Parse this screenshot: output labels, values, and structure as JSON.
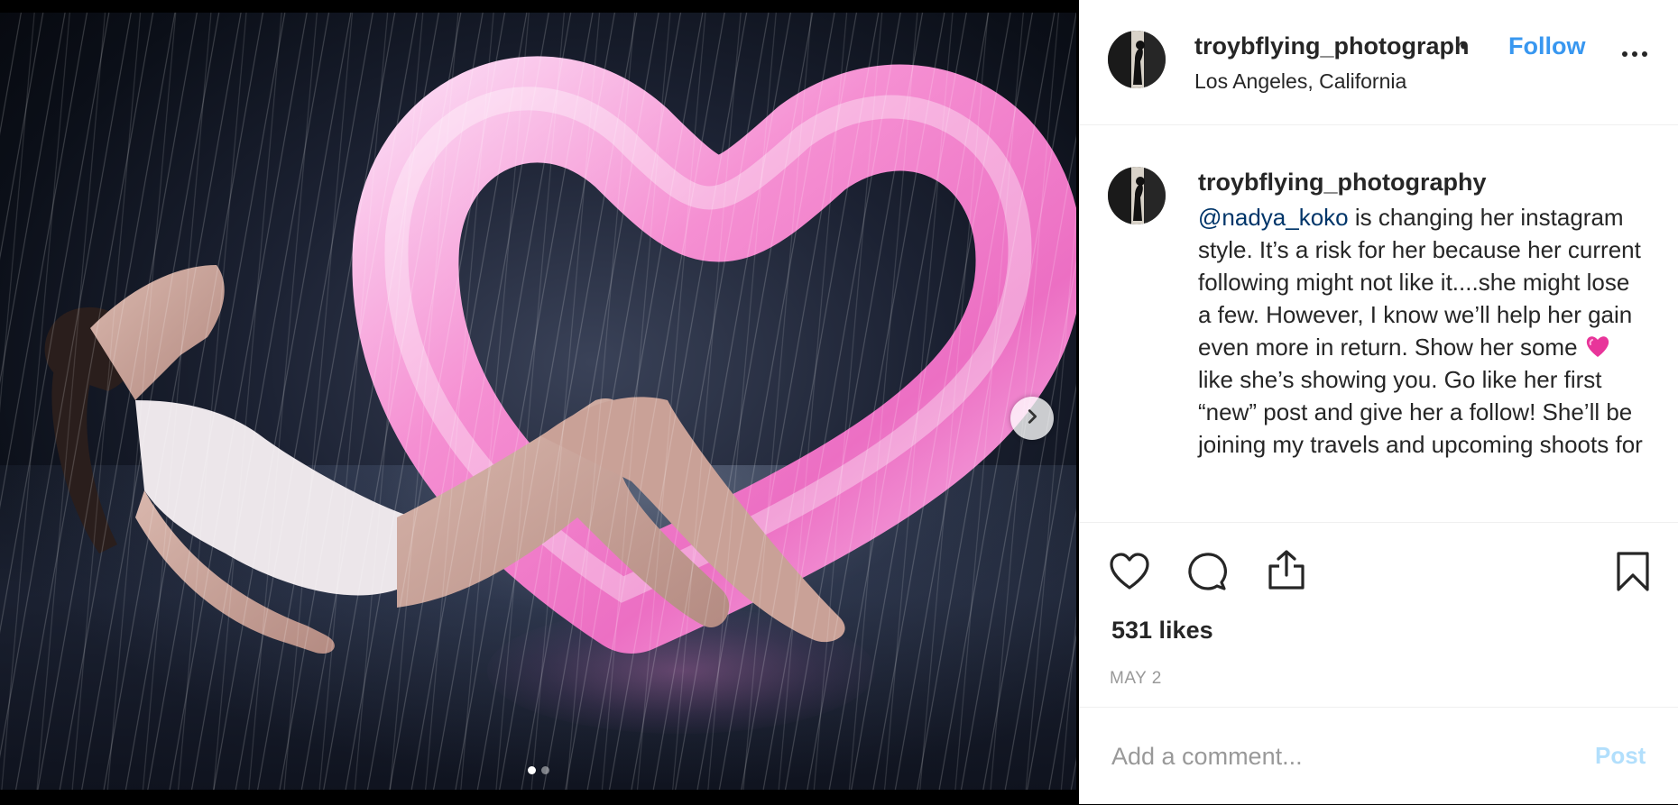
{
  "post": {
    "photo": {
      "slide_count": 2,
      "active_slide": 1
    },
    "header": {
      "username": "troybflying_photograph",
      "bullet": "•",
      "follow_label": "Follow",
      "location": "Los Angeles, California"
    },
    "caption": {
      "username": "troybflying_photography",
      "mention": "@nadya_koko",
      "text_part1": " is changing her instagram style. It’s a risk for her because her current following might not like it....she might lose a few. However, I know we’ll help her gain even more in return. Show her some ",
      "emoji": "pink-heart-emoji",
      "text_part2": "like she’s showing you. Go like her first “new” post and give her a follow! She’ll be joining my travels and upcoming shoots for"
    },
    "likes_text": "531 likes",
    "date_text": "MAY 2",
    "comment": {
      "placeholder": "Add a comment...",
      "post_label": "Post"
    }
  },
  "icons": {
    "carousel_next": "chevron-right-icon",
    "like": "heart-outline-icon",
    "comment": "speech-bubble-icon",
    "share": "share-upload-icon",
    "save": "bookmark-icon",
    "more": "more-options-icon"
  },
  "colors": {
    "accent": "#3897f0",
    "mention": "#003569",
    "post_disabled": "#b2dffc",
    "heart_inflatable": "#f58fd2"
  }
}
